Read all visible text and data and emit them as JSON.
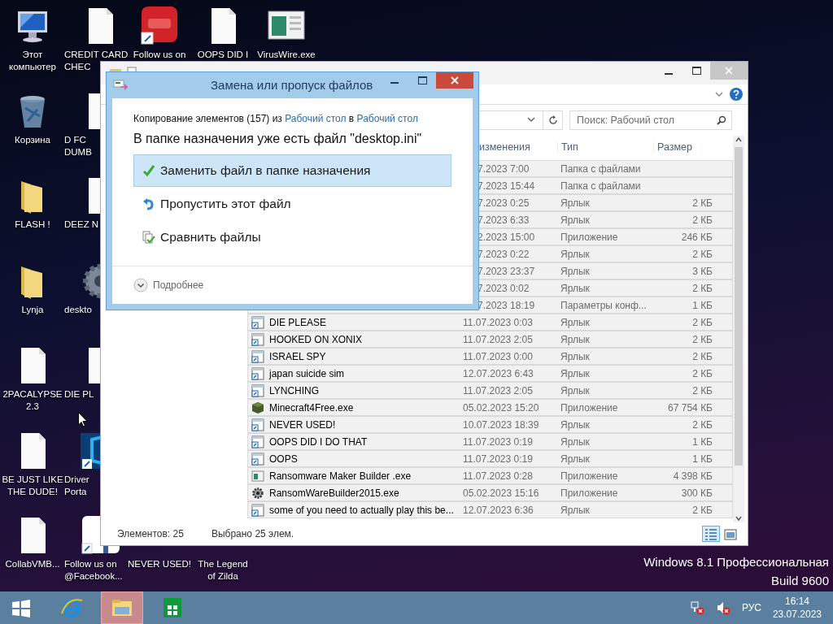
{
  "desktop": {
    "icon_columns": [
      [
        {
          "label": "Этот\nкомпьютер",
          "kind": "computer"
        },
        {
          "label": "Корзина",
          "kind": "recycle_bin"
        },
        {
          "label": "FLASH !",
          "kind": "folder"
        },
        {
          "label": "Lynja",
          "kind": "folder"
        },
        {
          "label": "2PACALYPSE\n2.3",
          "kind": "document"
        },
        {
          "label": "BE JUST LIKE\nTHE DUDE!",
          "kind": "document"
        },
        {
          "label": "CollabVMB...",
          "kind": "document"
        }
      ],
      [
        {
          "label": "CREDIT CARD\nCHEC",
          "kind": "document"
        },
        {
          "label": "D FC\nDUMB",
          "kind": "document"
        },
        {
          "label": "DEEZ N",
          "kind": "document"
        },
        {
          "label": "deskto",
          "kind": "gear"
        },
        {
          "label": "DIE PL",
          "kind": "document"
        },
        {
          "label": "Driver\nPorta",
          "kind": "driver_shortcut"
        },
        {
          "label": "Follow us on\n@Facebook...",
          "kind": "facebook_shortcut"
        }
      ],
      [
        {
          "label": "Follow us on",
          "kind": "youtube_shortcut"
        },
        {
          "label": "NEVER USED!",
          "kind": "covered"
        }
      ],
      [
        {
          "label": "OOPS DID I",
          "kind": "document"
        },
        {
          "label": "The Legend\nof Zilda",
          "kind": "covered"
        }
      ],
      [
        {
          "label": "VirusWire.exe",
          "kind": "app_window"
        }
      ]
    ],
    "edition": "Windows 8.1 Профессиональная",
    "build": "Build 9600"
  },
  "explorer": {
    "search": {
      "placeholder": "Поиск: Рабочий стол"
    },
    "columns": [
      "изменения",
      "Тип",
      "Размер"
    ],
    "rows": [
      {
        "date": "7.2023 7:00",
        "type": "Папка с файлами",
        "selected": true
      },
      {
        "date": "7.2023 15:44",
        "type": "Папка с файлами",
        "selected": true
      },
      {
        "date": "7.2023 0:25",
        "type": "Ярлык",
        "size": "2 КБ",
        "selected": true
      },
      {
        "date": "7.2023 6:33",
        "type": "Ярлык",
        "size": "2 КБ",
        "selected": true
      },
      {
        "date": "2.2023 15:00",
        "type": "Приложение",
        "size": "246 КБ",
        "selected": true
      },
      {
        "date": "7.2023 0:22",
        "type": "Ярлык",
        "size": "2 КБ",
        "selected": true
      },
      {
        "date": "7.2023 23:37",
        "type": "Ярлык",
        "size": "3 КБ",
        "selected": true
      },
      {
        "date": "7.2023 0:02",
        "type": "Ярлык",
        "size": "2 КБ",
        "selected": true
      },
      {
        "date": "7.2023 18:19",
        "type": "Параметры конф...",
        "size": "1 КБ",
        "selected": true
      },
      {
        "kind": "shortcut",
        "name": "DIE PLEASE",
        "date": "11.07.2023 0:03",
        "type": "Ярлык",
        "size": "2 КБ",
        "selected": true
      },
      {
        "kind": "shortcut",
        "name": "HOOKED ON XONIX",
        "date": "11.07.2023 2:05",
        "type": "Ярлык",
        "size": "2 КБ",
        "selected": true
      },
      {
        "kind": "shortcut",
        "name": "ISRAEL SPY",
        "date": "11.07.2023 0:00",
        "type": "Ярлык",
        "size": "2 КБ",
        "selected": true
      },
      {
        "kind": "shortcut",
        "name": "japan suicide sim",
        "date": "12.07.2023 6:43",
        "type": "Ярлык",
        "size": "2 КБ",
        "selected": true
      },
      {
        "kind": "shortcut",
        "name": "LYNCHING",
        "date": "11.07.2023 2:05",
        "type": "Ярлык",
        "size": "2 КБ",
        "selected": true
      },
      {
        "kind": "block",
        "name": "Minecraft4Free.exe",
        "date": "05.02.2023 15:20",
        "type": "Приложение",
        "size": "67 754 КБ",
        "selected": true
      },
      {
        "kind": "shortcut",
        "name": "NEVER USED!",
        "date": "10.07.2023 18:39",
        "type": "Ярлык",
        "size": "2 КБ",
        "selected": true
      },
      {
        "kind": "shortcut",
        "name": "OOPS DID I DO THAT",
        "date": "11.07.2023 0:19",
        "type": "Ярлык",
        "size": "1 КБ",
        "selected": true
      },
      {
        "kind": "shortcut",
        "name": "OOPS",
        "date": "11.07.2023 0:19",
        "type": "Ярлык",
        "size": "1 КБ",
        "selected": true
      },
      {
        "kind": "window",
        "name": "Ransomware Maker Builder .exe",
        "date": "11.07.2023 0:28",
        "type": "Приложение",
        "size": "4 398 КБ",
        "selected": true
      },
      {
        "kind": "gear",
        "name": "RansomWareBuilder2015.exe",
        "date": "05.02.2023 15:16",
        "type": "Приложение",
        "size": "300 КБ",
        "selected": true
      },
      {
        "kind": "shortcut",
        "name": "some of you need to actually play this be...",
        "date": "12.07.2023 6:36",
        "type": "Ярлык",
        "size": "2 КБ",
        "selected": true
      }
    ],
    "status_items": "Элементов: 25",
    "status_selected": "Выбрано 25 элем.",
    "views": [
      {
        "kind": "details",
        "selected": true
      },
      {
        "kind": "large_icons",
        "selected": false
      }
    ]
  },
  "dialog": {
    "title": "Замена или пропуск файлов",
    "copy_line": {
      "prefix": "Копирование элементов (157) из ",
      "source": "Рабочий стол",
      "joiner": " в ",
      "destination": "Рабочий стол"
    },
    "heading": "В папке назначения уже есть файл \"desktop.ini\"",
    "options": [
      {
        "kind": "replace",
        "label": "Заменить файл в папке назначения",
        "selected": true
      },
      {
        "kind": "skip",
        "label": "Пропустить этот файл",
        "selected": false
      },
      {
        "kind": "compare",
        "label": "Сравнить файлы",
        "selected": false
      }
    ],
    "more": "Подробнее"
  },
  "taskbar": {
    "apps": [
      {
        "kind": "start",
        "selected": false
      },
      {
        "kind": "browser",
        "selected": false
      },
      {
        "kind": "explorer",
        "selected": true
      },
      {
        "kind": "store",
        "selected": false
      }
    ],
    "language": "РУС",
    "time": "16:14",
    "date": "23.07.2023"
  }
}
